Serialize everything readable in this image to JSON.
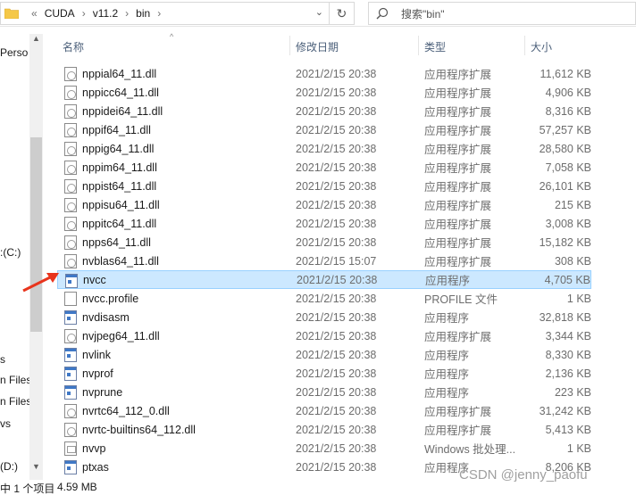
{
  "address": {
    "overflow": "«",
    "crumbs": [
      "CUDA",
      "v11.2",
      "bin"
    ],
    "separator": "›"
  },
  "search": {
    "placeholder": "搜索\"bin\""
  },
  "nav": {
    "items": [
      {
        "label": "Perso"
      },
      {
        "label": ":(C:)"
      },
      {
        "label": "s"
      },
      {
        "label": "n Files"
      },
      {
        "label": "n Files"
      },
      {
        "label": "vs"
      },
      {
        "label": "(D:)"
      }
    ]
  },
  "columns": {
    "name": "名称",
    "date": "修改日期",
    "type": "类型",
    "size": "大小"
  },
  "files": [
    {
      "name": "nppial64_11.dll",
      "date": "2021/2/15 20:38",
      "type": "应用程序扩展",
      "size": "11,612 KB",
      "icon": "dll-icon"
    },
    {
      "name": "nppicc64_11.dll",
      "date": "2021/2/15 20:38",
      "type": "应用程序扩展",
      "size": "4,906 KB",
      "icon": "dll-icon"
    },
    {
      "name": "nppidei64_11.dll",
      "date": "2021/2/15 20:38",
      "type": "应用程序扩展",
      "size": "8,316 KB",
      "icon": "dll-icon"
    },
    {
      "name": "nppif64_11.dll",
      "date": "2021/2/15 20:38",
      "type": "应用程序扩展",
      "size": "57,257 KB",
      "icon": "dll-icon"
    },
    {
      "name": "nppig64_11.dll",
      "date": "2021/2/15 20:38",
      "type": "应用程序扩展",
      "size": "28,580 KB",
      "icon": "dll-icon"
    },
    {
      "name": "nppim64_11.dll",
      "date": "2021/2/15 20:38",
      "type": "应用程序扩展",
      "size": "7,058 KB",
      "icon": "dll-icon"
    },
    {
      "name": "nppist64_11.dll",
      "date": "2021/2/15 20:38",
      "type": "应用程序扩展",
      "size": "26,101 KB",
      "icon": "dll-icon"
    },
    {
      "name": "nppisu64_11.dll",
      "date": "2021/2/15 20:38",
      "type": "应用程序扩展",
      "size": "215 KB",
      "icon": "dll-icon"
    },
    {
      "name": "nppitc64_11.dll",
      "date": "2021/2/15 20:38",
      "type": "应用程序扩展",
      "size": "3,008 KB",
      "icon": "dll-icon"
    },
    {
      "name": "npps64_11.dll",
      "date": "2021/2/15 20:38",
      "type": "应用程序扩展",
      "size": "15,182 KB",
      "icon": "dll-icon"
    },
    {
      "name": "nvblas64_11.dll",
      "date": "2021/2/15 15:07",
      "type": "应用程序扩展",
      "size": "308 KB",
      "icon": "dll-icon"
    },
    {
      "name": "nvcc",
      "date": "2021/2/15 20:38",
      "type": "应用程序",
      "size": "4,705 KB",
      "icon": "exe-icon",
      "selected": true
    },
    {
      "name": "nvcc.profile",
      "date": "2021/2/15 20:38",
      "type": "PROFILE 文件",
      "size": "1 KB",
      "icon": "document-icon"
    },
    {
      "name": "nvdisasm",
      "date": "2021/2/15 20:38",
      "type": "应用程序",
      "size": "32,818 KB",
      "icon": "exe-icon"
    },
    {
      "name": "nvjpeg64_11.dll",
      "date": "2021/2/15 20:38",
      "type": "应用程序扩展",
      "size": "3,344 KB",
      "icon": "dll-icon"
    },
    {
      "name": "nvlink",
      "date": "2021/2/15 20:38",
      "type": "应用程序",
      "size": "8,330 KB",
      "icon": "exe-icon"
    },
    {
      "name": "nvprof",
      "date": "2021/2/15 20:38",
      "type": "应用程序",
      "size": "2,136 KB",
      "icon": "exe-icon"
    },
    {
      "name": "nvprune",
      "date": "2021/2/15 20:38",
      "type": "应用程序",
      "size": "223 KB",
      "icon": "exe-icon"
    },
    {
      "name": "nvrtc64_112_0.dll",
      "date": "2021/2/15 20:38",
      "type": "应用程序扩展",
      "size": "31,242 KB",
      "icon": "dll-icon"
    },
    {
      "name": "nvrtc-builtins64_112.dll",
      "date": "2021/2/15 20:38",
      "type": "应用程序扩展",
      "size": "5,413 KB",
      "icon": "dll-icon"
    },
    {
      "name": "nvvp",
      "date": "2021/2/15 20:38",
      "type": "Windows 批处理...",
      "size": "1 KB",
      "icon": "batch-file-icon"
    },
    {
      "name": "ptxas",
      "date": "2021/2/15 20:38",
      "type": "应用程序",
      "size": "8,206 KB",
      "icon": "exe-icon"
    }
  ],
  "status": {
    "selection": "中 1 个项目",
    "size": "4.59 MB"
  },
  "watermark": "CSDN @jenny_paofu",
  "colors": {
    "selection_bg": "#cce8ff",
    "selection_border": "#99d1ff",
    "arrow": "#e8341c"
  }
}
